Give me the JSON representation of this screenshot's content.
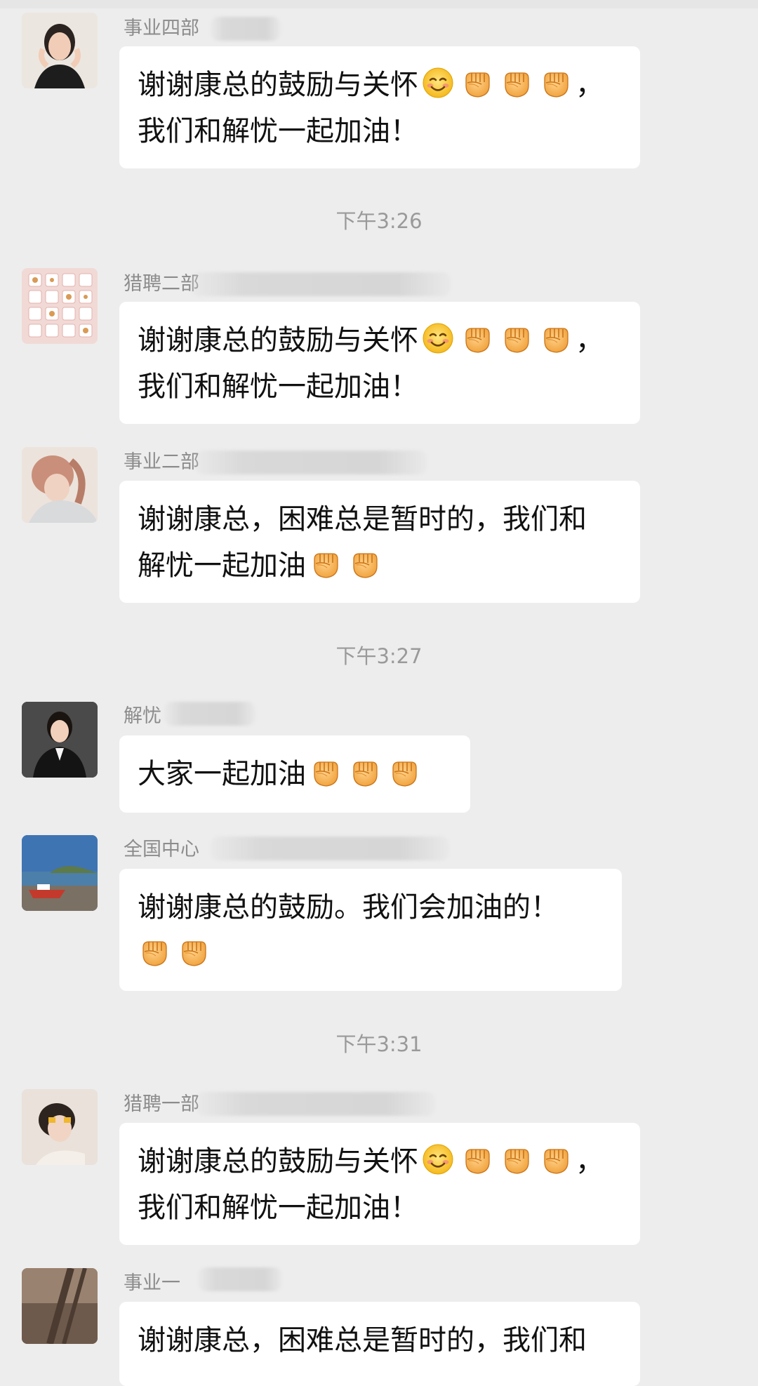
{
  "times": [
    "下午3:26",
    "下午3:27",
    "下午3:31"
  ],
  "messages": [
    {
      "sender": "事业四部",
      "lines": [
        "谢谢康总的鼓励与关怀",
        "我们和解忧一起加油！"
      ],
      "line1_suffix": "，"
    },
    {
      "sender": "猎聘二部",
      "lines": [
        "谢谢康总的鼓励与关怀",
        "我们和解忧一起加油！"
      ],
      "line1_suffix": "，"
    },
    {
      "sender": "事业二部",
      "lines": [
        "谢谢康总，困难总是暂时的，我们和",
        "解忧一起加油"
      ]
    },
    {
      "sender": "解忧",
      "lines": [
        "大家一起加油"
      ]
    },
    {
      "sender": "全国中心",
      "lines": [
        "谢谢康总的鼓励。我们会加油的！"
      ]
    },
    {
      "sender": "猎聘一部",
      "lines": [
        "谢谢康总的鼓励与关怀",
        "我们和解忧一起加油！"
      ],
      "line1_suffix": "，"
    },
    {
      "sender": "事业一",
      "lines": [
        "谢谢康总，困难总是暂时的，我们和"
      ]
    }
  ],
  "emoji_names": [
    "smiling-face-emoji",
    "raised-fist-emoji"
  ],
  "colors": {
    "background": "#ededed",
    "bubble": "#ffffff",
    "meta_text": "#8c8c8c"
  }
}
